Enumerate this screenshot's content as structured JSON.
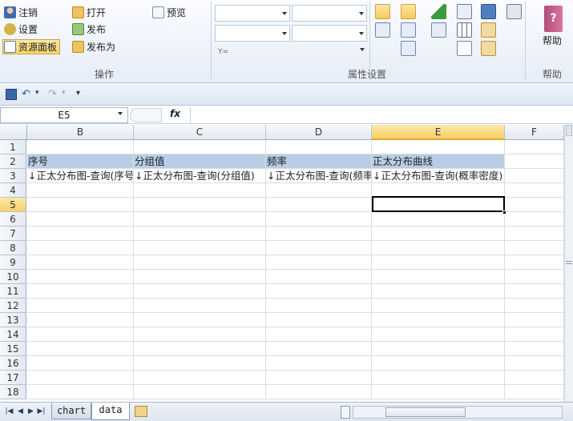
{
  "ribbon": {
    "ops": {
      "logout": "注销",
      "settings": "设置",
      "resource_panel": "资源面板",
      "open": "打开",
      "publish": "发布",
      "publish_as": "发布为",
      "preview": "预览",
      "label": "操作"
    },
    "props_label": "属性设置",
    "filter_symbol": "Y=",
    "help_button": "帮助",
    "help_label": "帮助"
  },
  "qat": {
    "customize": "▾"
  },
  "formula_bar": {
    "name_box": "E5",
    "fx": "fx",
    "formula": ""
  },
  "sheet": {
    "columns": [
      {
        "label": "B",
        "selected": false
      },
      {
        "label": "C",
        "selected": false
      },
      {
        "label": "D",
        "selected": false
      },
      {
        "label": "E",
        "selected": true
      },
      {
        "label": "F",
        "selected": false
      }
    ],
    "rows": [
      "1",
      "2",
      "3",
      "4",
      "5",
      "6",
      "7",
      "8",
      "9",
      "10",
      "11",
      "12",
      "13",
      "14",
      "15",
      "16",
      "17",
      "18"
    ],
    "selected_row": "5",
    "header_row": [
      "序号",
      "分组值",
      "频率",
      "正太分布曲线"
    ],
    "data_row": [
      "↓正太分布图-查询(序号)",
      "↓正太分布图-查询(分组值)",
      "↓正太分布图-查询(频率)",
      "↓正太分布图-查询(概率密度)"
    ]
  },
  "tabs": {
    "nav": [
      "|◀",
      "◀",
      "▶",
      "▶|"
    ],
    "sheets": [
      {
        "label": "chart",
        "active": false
      },
      {
        "label": "data",
        "active": true
      }
    ]
  },
  "colors": {
    "header_fill": "#b9cde5",
    "accent": "#f7cf67"
  }
}
